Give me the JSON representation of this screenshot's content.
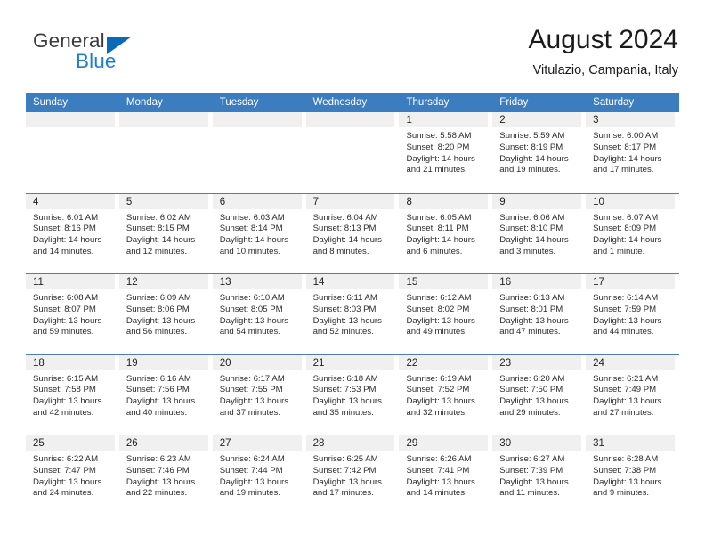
{
  "brand": {
    "name_top": "General",
    "name_bottom": "Blue",
    "color_dark": "#3c3c3c",
    "color_blue": "#1a7fd4"
  },
  "header": {
    "title": "August 2024",
    "subtitle": "Vitulazio, Campania, Italy"
  },
  "theme": {
    "header_row_bg": "#3b7dbf",
    "row_divider": "#4a7fb5",
    "day_band_bg": "#f0f0f0"
  },
  "weekdays": [
    "Sunday",
    "Monday",
    "Tuesday",
    "Wednesday",
    "Thursday",
    "Friday",
    "Saturday"
  ],
  "weeks": [
    [
      {
        "day": "",
        "empty": true
      },
      {
        "day": "",
        "empty": true
      },
      {
        "day": "",
        "empty": true
      },
      {
        "day": "",
        "empty": true
      },
      {
        "day": "1",
        "sunrise": "Sunrise: 5:58 AM",
        "sunset": "Sunset: 8:20 PM",
        "daylight": "Daylight: 14 hours and 21 minutes."
      },
      {
        "day": "2",
        "sunrise": "Sunrise: 5:59 AM",
        "sunset": "Sunset: 8:19 PM",
        "daylight": "Daylight: 14 hours and 19 minutes."
      },
      {
        "day": "3",
        "sunrise": "Sunrise: 6:00 AM",
        "sunset": "Sunset: 8:17 PM",
        "daylight": "Daylight: 14 hours and 17 minutes."
      }
    ],
    [
      {
        "day": "4",
        "sunrise": "Sunrise: 6:01 AM",
        "sunset": "Sunset: 8:16 PM",
        "daylight": "Daylight: 14 hours and 14 minutes."
      },
      {
        "day": "5",
        "sunrise": "Sunrise: 6:02 AM",
        "sunset": "Sunset: 8:15 PM",
        "daylight": "Daylight: 14 hours and 12 minutes."
      },
      {
        "day": "6",
        "sunrise": "Sunrise: 6:03 AM",
        "sunset": "Sunset: 8:14 PM",
        "daylight": "Daylight: 14 hours and 10 minutes."
      },
      {
        "day": "7",
        "sunrise": "Sunrise: 6:04 AM",
        "sunset": "Sunset: 8:13 PM",
        "daylight": "Daylight: 14 hours and 8 minutes."
      },
      {
        "day": "8",
        "sunrise": "Sunrise: 6:05 AM",
        "sunset": "Sunset: 8:11 PM",
        "daylight": "Daylight: 14 hours and 6 minutes."
      },
      {
        "day": "9",
        "sunrise": "Sunrise: 6:06 AM",
        "sunset": "Sunset: 8:10 PM",
        "daylight": "Daylight: 14 hours and 3 minutes."
      },
      {
        "day": "10",
        "sunrise": "Sunrise: 6:07 AM",
        "sunset": "Sunset: 8:09 PM",
        "daylight": "Daylight: 14 hours and 1 minute."
      }
    ],
    [
      {
        "day": "11",
        "sunrise": "Sunrise: 6:08 AM",
        "sunset": "Sunset: 8:07 PM",
        "daylight": "Daylight: 13 hours and 59 minutes."
      },
      {
        "day": "12",
        "sunrise": "Sunrise: 6:09 AM",
        "sunset": "Sunset: 8:06 PM",
        "daylight": "Daylight: 13 hours and 56 minutes."
      },
      {
        "day": "13",
        "sunrise": "Sunrise: 6:10 AM",
        "sunset": "Sunset: 8:05 PM",
        "daylight": "Daylight: 13 hours and 54 minutes."
      },
      {
        "day": "14",
        "sunrise": "Sunrise: 6:11 AM",
        "sunset": "Sunset: 8:03 PM",
        "daylight": "Daylight: 13 hours and 52 minutes."
      },
      {
        "day": "15",
        "sunrise": "Sunrise: 6:12 AM",
        "sunset": "Sunset: 8:02 PM",
        "daylight": "Daylight: 13 hours and 49 minutes."
      },
      {
        "day": "16",
        "sunrise": "Sunrise: 6:13 AM",
        "sunset": "Sunset: 8:01 PM",
        "daylight": "Daylight: 13 hours and 47 minutes."
      },
      {
        "day": "17",
        "sunrise": "Sunrise: 6:14 AM",
        "sunset": "Sunset: 7:59 PM",
        "daylight": "Daylight: 13 hours and 44 minutes."
      }
    ],
    [
      {
        "day": "18",
        "sunrise": "Sunrise: 6:15 AM",
        "sunset": "Sunset: 7:58 PM",
        "daylight": "Daylight: 13 hours and 42 minutes."
      },
      {
        "day": "19",
        "sunrise": "Sunrise: 6:16 AM",
        "sunset": "Sunset: 7:56 PM",
        "daylight": "Daylight: 13 hours and 40 minutes."
      },
      {
        "day": "20",
        "sunrise": "Sunrise: 6:17 AM",
        "sunset": "Sunset: 7:55 PM",
        "daylight": "Daylight: 13 hours and 37 minutes."
      },
      {
        "day": "21",
        "sunrise": "Sunrise: 6:18 AM",
        "sunset": "Sunset: 7:53 PM",
        "daylight": "Daylight: 13 hours and 35 minutes."
      },
      {
        "day": "22",
        "sunrise": "Sunrise: 6:19 AM",
        "sunset": "Sunset: 7:52 PM",
        "daylight": "Daylight: 13 hours and 32 minutes."
      },
      {
        "day": "23",
        "sunrise": "Sunrise: 6:20 AM",
        "sunset": "Sunset: 7:50 PM",
        "daylight": "Daylight: 13 hours and 29 minutes."
      },
      {
        "day": "24",
        "sunrise": "Sunrise: 6:21 AM",
        "sunset": "Sunset: 7:49 PM",
        "daylight": "Daylight: 13 hours and 27 minutes."
      }
    ],
    [
      {
        "day": "25",
        "sunrise": "Sunrise: 6:22 AM",
        "sunset": "Sunset: 7:47 PM",
        "daylight": "Daylight: 13 hours and 24 minutes."
      },
      {
        "day": "26",
        "sunrise": "Sunrise: 6:23 AM",
        "sunset": "Sunset: 7:46 PM",
        "daylight": "Daylight: 13 hours and 22 minutes."
      },
      {
        "day": "27",
        "sunrise": "Sunrise: 6:24 AM",
        "sunset": "Sunset: 7:44 PM",
        "daylight": "Daylight: 13 hours and 19 minutes."
      },
      {
        "day": "28",
        "sunrise": "Sunrise: 6:25 AM",
        "sunset": "Sunset: 7:42 PM",
        "daylight": "Daylight: 13 hours and 17 minutes."
      },
      {
        "day": "29",
        "sunrise": "Sunrise: 6:26 AM",
        "sunset": "Sunset: 7:41 PM",
        "daylight": "Daylight: 13 hours and 14 minutes."
      },
      {
        "day": "30",
        "sunrise": "Sunrise: 6:27 AM",
        "sunset": "Sunset: 7:39 PM",
        "daylight": "Daylight: 13 hours and 11 minutes."
      },
      {
        "day": "31",
        "sunrise": "Sunrise: 6:28 AM",
        "sunset": "Sunset: 7:38 PM",
        "daylight": "Daylight: 13 hours and 9 minutes."
      }
    ]
  ]
}
